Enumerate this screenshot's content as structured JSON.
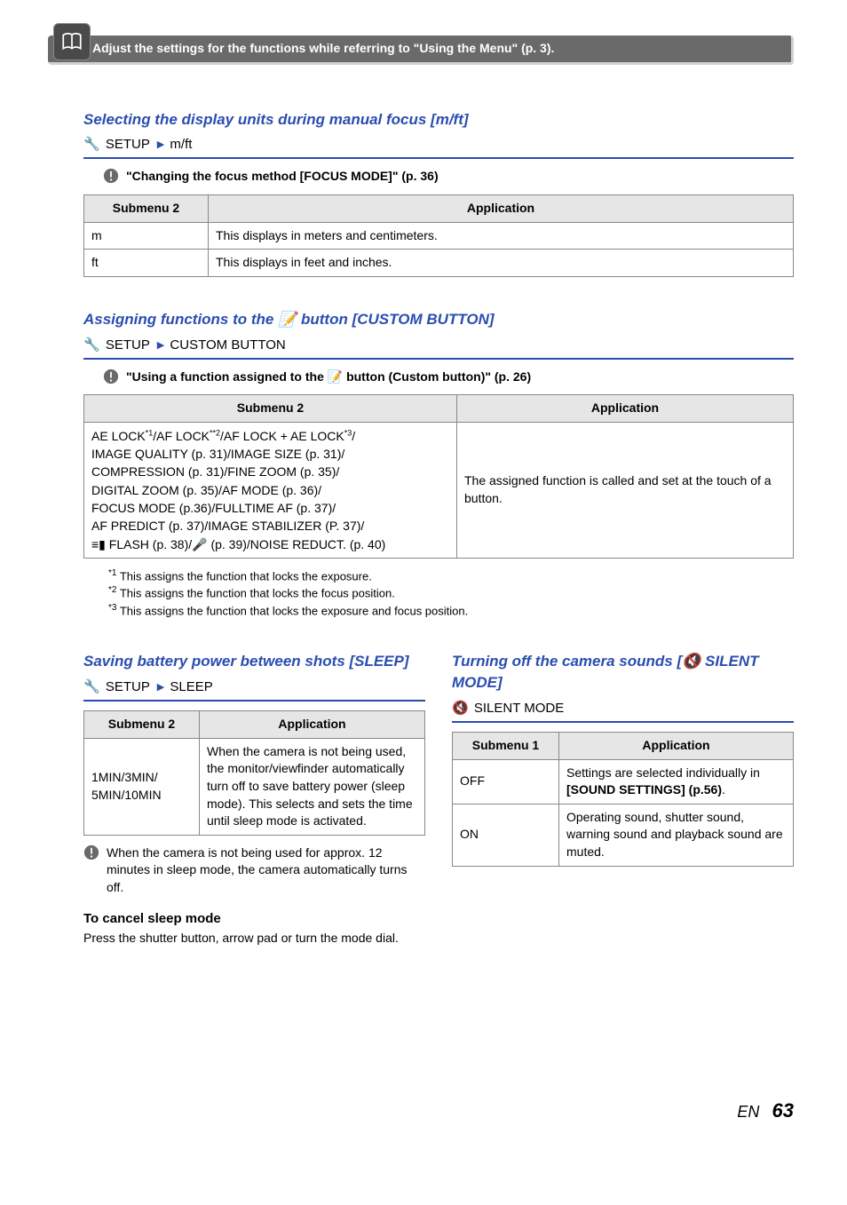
{
  "topbar": "Adjust the settings for the functions while referring to \"Using the Menu\" (p. 3).",
  "displayUnits": {
    "title": "Selecting the display units during manual focus [m/ft]",
    "breadcrumb_prefix_glyph": "🔧",
    "breadcrumb_parts": [
      "SETUP",
      "m/ft"
    ],
    "note": "\"Changing the focus method [FOCUS MODE]\" (p. 36)",
    "headers": [
      "Submenu 2",
      "Application"
    ],
    "rows": [
      [
        "m",
        "This displays in meters and centimeters."
      ],
      [
        "ft",
        "This displays in feet and inches."
      ]
    ]
  },
  "customButton": {
    "title_prefix": "Assigning functions to the ",
    "title_suffix": " button [CUSTOM BUTTON]",
    "breadcrumb_parts": [
      "SETUP",
      "CUSTOM BUTTON"
    ],
    "note": "\"Using a function assigned to the 📝 button (Custom button)\" (p. 26)",
    "headers": [
      "Submenu 2",
      "Application"
    ],
    "submenu2_lines": [
      "AE LOCK*1/AF LOCK*2/AF LOCK + AE LOCK*3/",
      "IMAGE QUALITY (p. 31)/IMAGE SIZE (p. 31)/",
      "COMPRESSION (p. 31)/FINE ZOOM (p. 35)/",
      "DIGITAL ZOOM (p. 35)/AF MODE (p. 36)/",
      "FOCUS MODE (p.36)/FULLTIME AF (p. 37)/",
      "AF PREDICT (p. 37)/IMAGE STABILIZER (P. 37)/",
      "≡▮ FLASH (p. 38)/🎤 (p. 39)/NOISE REDUCT. (p. 40)"
    ],
    "application": "The assigned function is called and set at the touch of a button.",
    "footnotes": [
      "*1 This assigns the function that locks the exposure.",
      "*2 This assigns the function that locks the focus position.",
      "*3 This assigns the function that locks the exposure and focus position."
    ]
  },
  "sleep": {
    "title": "Saving battery power between shots [SLEEP]",
    "breadcrumb_parts": [
      "SETUP",
      "SLEEP"
    ],
    "headers": [
      "Submenu 2",
      "Application"
    ],
    "row_sub": "1MIN/3MIN/\n5MIN/10MIN",
    "row_app": "When the camera is not being used, the monitor/viewfinder automatically turn off to save battery power (sleep mode). This selects and sets the time until sleep mode is activated.",
    "note": "When the camera is not being used for approx. 12 minutes in sleep mode, the camera automatically turns off.",
    "cancel_head": "To cancel sleep mode",
    "cancel_body": "Press the shutter button, arrow pad or turn the mode dial."
  },
  "silent": {
    "title_prefix": "Turning off the camera sounds [",
    "title_suffix": " SILENT MODE]",
    "breadcrumb": "SILENT MODE",
    "headers": [
      "Submenu 1",
      "Application"
    ],
    "rows": [
      [
        "OFF",
        "Settings are selected individually in [SOUND SETTINGS] (p.56)."
      ],
      [
        "ON",
        "Operating sound, shutter sound, warning sound and playback sound are muted."
      ]
    ],
    "bold_frag": "[SOUND SETTINGS] (p.56)"
  },
  "footer": {
    "en": "EN",
    "page": "63"
  }
}
